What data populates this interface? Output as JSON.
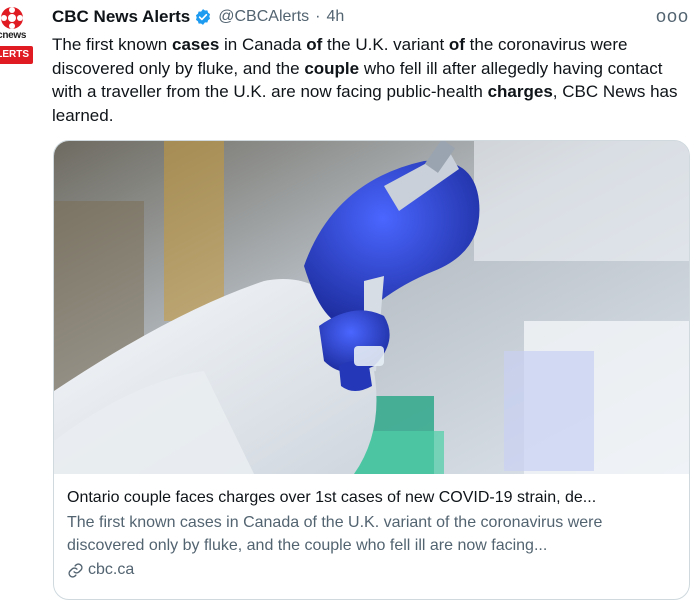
{
  "account": {
    "display_name": "CBC News Alerts",
    "handle": "@CBCAlerts",
    "separator": "·",
    "time": "4h",
    "avatar_text_top": "cbcnews",
    "avatar_text_bottom": "ALERTS"
  },
  "more_label": "ooo",
  "tweet": {
    "segments": [
      {
        "text": "The first known ",
        "bold": false
      },
      {
        "text": "cases",
        "bold": true
      },
      {
        "text": " in Canada ",
        "bold": false
      },
      {
        "text": "of",
        "bold": true
      },
      {
        "text": " the U.K. variant ",
        "bold": false
      },
      {
        "text": "of",
        "bold": true
      },
      {
        "text": " the coronavirus were discovered only by fluke, and the ",
        "bold": false
      },
      {
        "text": "couple",
        "bold": true
      },
      {
        "text": " who fell ill after allegedly having contact with a traveller from the U.K. are now facing public-health ",
        "bold": false
      },
      {
        "text": "charges",
        "bold": true
      },
      {
        "text": ", CBC News has learned.",
        "bold": false
      }
    ]
  },
  "card": {
    "title": "Ontario couple faces charges over 1st cases of new COVID-19 strain, de...",
    "description": "The first known cases in Canada of the U.K. variant of the coronavirus were discovered only by fluke, and the couple who fell ill are now facing...",
    "domain": "cbc.ca"
  },
  "colors": {
    "verified": "#1d9bf0",
    "alerts_red": "#e01b22",
    "glove_blue": "#2f46c9"
  }
}
